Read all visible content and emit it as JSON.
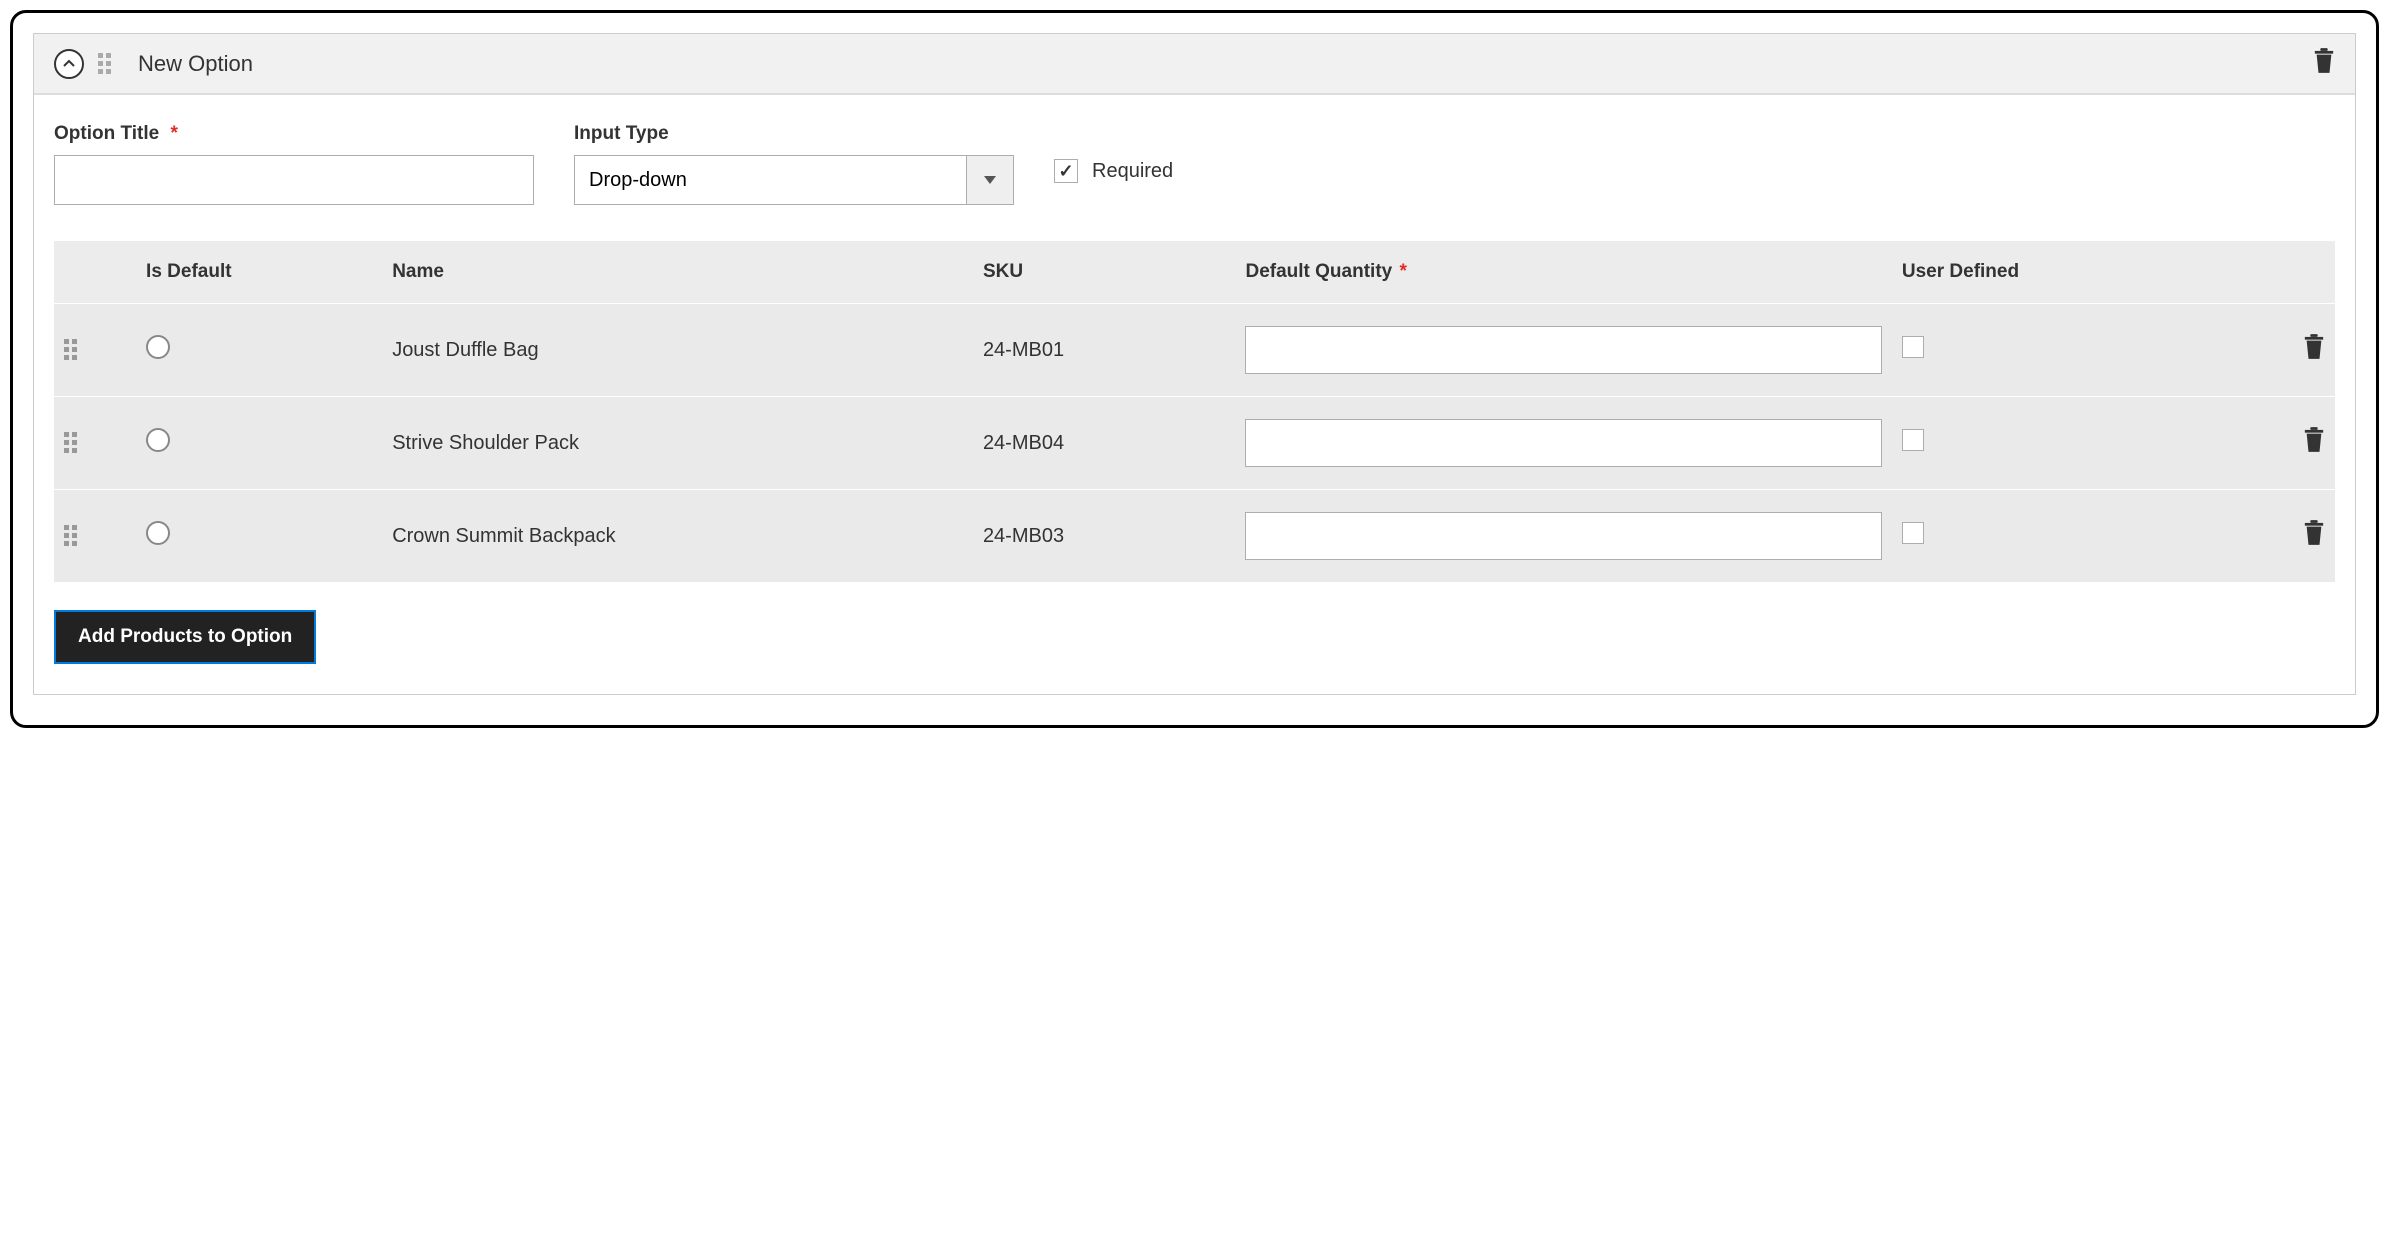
{
  "panel": {
    "title": "New Option"
  },
  "form": {
    "option_title_label": "Option Title",
    "option_title_value": "",
    "input_type_label": "Input Type",
    "input_type_value": "Drop-down",
    "required_label": "Required",
    "required_checked": true
  },
  "table": {
    "headers": {
      "is_default": "Is Default",
      "name": "Name",
      "sku": "SKU",
      "default_qty": "Default Quantity",
      "user_defined": "User Defined"
    },
    "rows": [
      {
        "name": "Joust Duffle Bag",
        "sku": "24-MB01",
        "qty": "",
        "user_defined": false
      },
      {
        "name": "Strive Shoulder Pack",
        "sku": "24-MB04",
        "qty": "",
        "user_defined": false
      },
      {
        "name": "Crown Summit Backpack",
        "sku": "24-MB03",
        "qty": "",
        "user_defined": false
      }
    ]
  },
  "buttons": {
    "add_products": "Add Products to Option"
  }
}
